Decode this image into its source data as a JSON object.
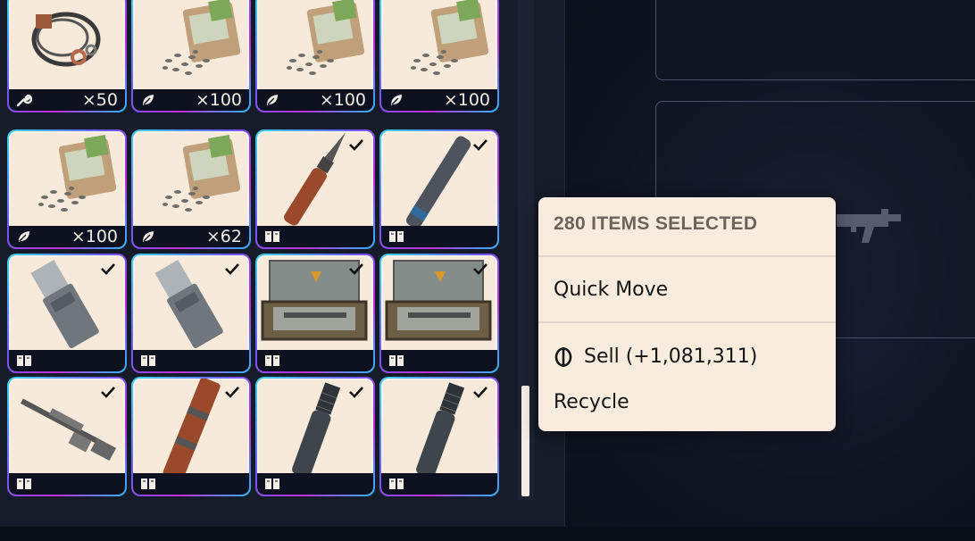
{
  "inventory": {
    "rows": [
      [
        {
          "kind": "wire",
          "footer_icon": "wrench-icon",
          "count": "×50",
          "checked": false
        },
        {
          "kind": "seeds",
          "footer_icon": "leaf-icon",
          "count": "×100",
          "checked": false
        },
        {
          "kind": "seeds",
          "footer_icon": "leaf-icon",
          "count": "×100",
          "checked": false
        },
        {
          "kind": "seeds",
          "footer_icon": "leaf-icon",
          "count": "×100",
          "checked": false
        }
      ],
      [
        {
          "kind": "seeds",
          "footer_icon": "leaf-icon",
          "count": "×100",
          "checked": false
        },
        {
          "kind": "seeds",
          "footer_icon": "leaf-icon",
          "count": "×62",
          "checked": false
        },
        {
          "kind": "bayonet",
          "footer_icon": "book-icon",
          "count": "",
          "checked": true
        },
        {
          "kind": "tube",
          "footer_icon": "book-icon",
          "count": "",
          "checked": true
        }
      ],
      [
        {
          "kind": "magazine",
          "footer_icon": "book-icon",
          "count": "",
          "checked": true
        },
        {
          "kind": "magazine",
          "footer_icon": "book-icon",
          "count": "",
          "checked": true
        },
        {
          "kind": "case",
          "footer_icon": "book-icon",
          "count": "",
          "checked": true
        },
        {
          "kind": "case",
          "footer_icon": "book-icon",
          "count": "",
          "checked": true
        }
      ],
      [
        {
          "kind": "rifle",
          "footer_icon": "book-icon",
          "count": "",
          "checked": true
        },
        {
          "kind": "woodtube",
          "footer_icon": "book-icon",
          "count": "",
          "checked": true
        },
        {
          "kind": "suppressor",
          "footer_icon": "book-icon",
          "count": "",
          "checked": true
        },
        {
          "kind": "suppressor",
          "footer_icon": "book-icon",
          "count": "",
          "checked": true
        }
      ]
    ]
  },
  "context_menu": {
    "header": "280 ITEMS SELECTED",
    "quick_move": "Quick Move",
    "sell": "Sell (+1,081,311)",
    "sell_icon": "coin-icon",
    "recycle": "Recycle"
  },
  "colors": {
    "card_bg": "#f8eadb",
    "footer_bg": "#0d1120",
    "menu_bg": "#f8ecdf",
    "accent_gradient": [
      "#36d6e8",
      "#6b5bff",
      "#c02ed8"
    ]
  }
}
